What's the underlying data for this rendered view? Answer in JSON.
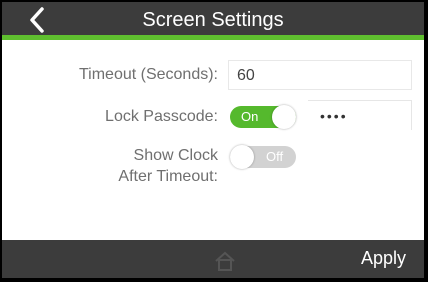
{
  "header": {
    "title": "Screen Settings",
    "back_icon": "chevron-left-icon"
  },
  "settings": {
    "timeout": {
      "label": "Timeout (Seconds):",
      "value": "60"
    },
    "lock_passcode": {
      "label": "Lock Passcode:",
      "toggle_text": "On",
      "state": "on",
      "passcode_mask": "••••"
    },
    "show_clock": {
      "label_line1": "Show Clock",
      "label_line2": "After Timeout:",
      "toggle_text": "Off",
      "state": "off"
    }
  },
  "footer": {
    "home_icon": "home-icon",
    "apply_label": "Apply"
  },
  "colors": {
    "header_bg": "#3c3c3c",
    "accent": "#5fbf2f",
    "toggle_on": "#55b92d",
    "toggle_off": "#d2d2d2"
  }
}
